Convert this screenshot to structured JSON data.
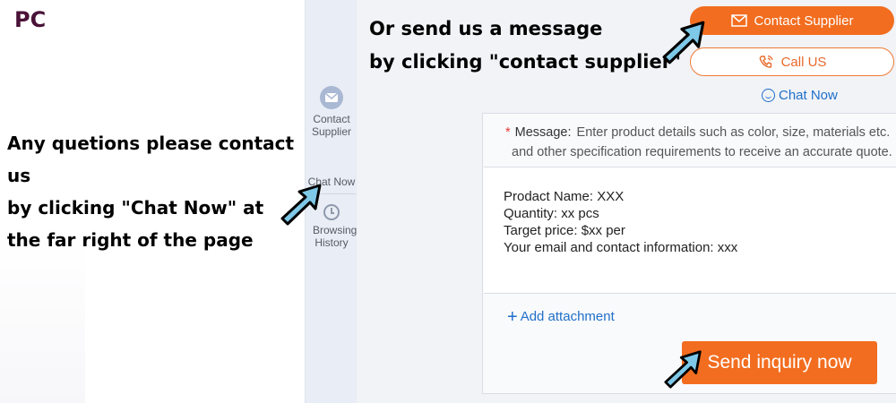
{
  "platform_label": "PC",
  "left_note": {
    "lines": [
      "Any quetions please contact us",
      "by clicking \"Chat Now\" at",
      "the far right of the page"
    ]
  },
  "top_note": {
    "lines": [
      "Or send us a message",
      "by clicking \"contact supplier\""
    ]
  },
  "sidebar": {
    "contact_supplier": "Contact Supplier",
    "chat_now": "Chat Now",
    "browsing_history": "Browsing History"
  },
  "actions": {
    "contact_supplier": "Contact Supplier",
    "call_us": "Call US",
    "chat_now": "Chat Now"
  },
  "inquiry_form": {
    "message_label": "Message:",
    "message_hint_line1": "Enter product details such as color, size, materials etc.",
    "message_hint_line2": "and other specification requirements to receive an accurate quote.",
    "body_lines": [
      "Prodact Name: XXX",
      "Quantity: xx pcs",
      "Target price: $xx per",
      "Your email and contact information: xxx"
    ],
    "add_attachment": "Add attachment",
    "send_button": "Send inquiry now"
  },
  "colors": {
    "accent_orange": "#f26d1f",
    "link_blue": "#1f6fc9",
    "sidebar_bg": "#e9edf5"
  },
  "icons": [
    "mail-icon",
    "phone-icon",
    "smile-icon",
    "clock-icon",
    "plus-icon",
    "cursor-arrow-icon"
  ]
}
